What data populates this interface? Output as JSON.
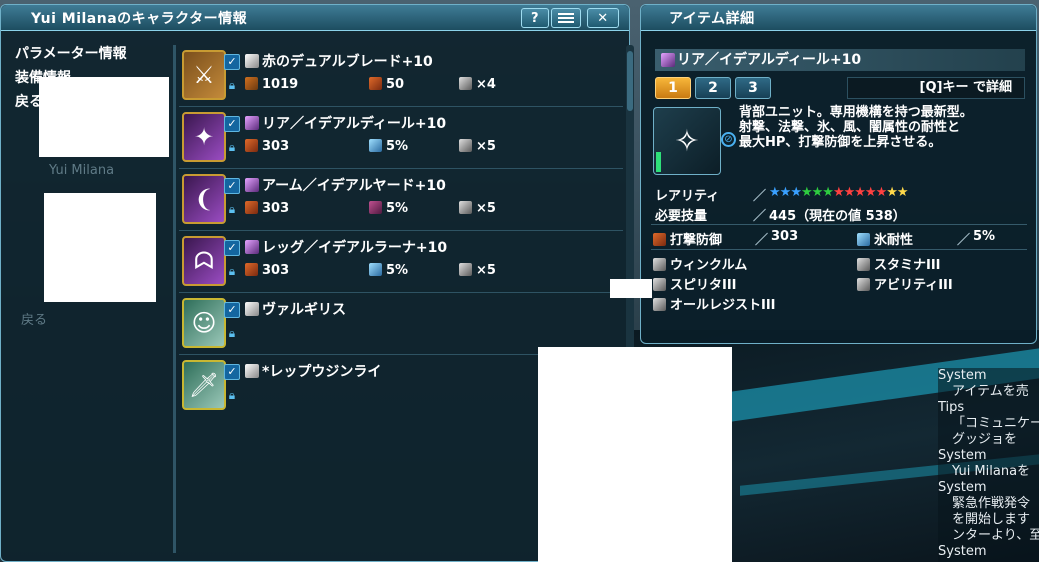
{
  "left_window": {
    "title": "Yui Milanaのキャラクター情報",
    "buttons": {
      "help": "?",
      "menu": "",
      "close": "✕"
    },
    "sidebar": {
      "items": [
        {
          "label": "パラメーター情報"
        },
        {
          "label": "装備情報"
        },
        {
          "label": "戻る"
        }
      ],
      "ghost_name": "Yui Milana",
      "ghost_back": "戻る"
    },
    "equipment": [
      {
        "name": "赤のデュアルブレード+10",
        "icon": "dual-blades-icon",
        "color": "orange",
        "stat1_value": "1019",
        "stat2_value": "50",
        "slots": "×4"
      },
      {
        "name": "リア／イデアルディール+10",
        "icon": "rear-unit-icon",
        "color": "purple",
        "stat1_value": "303",
        "stat2_value": "5%",
        "slots": "×5"
      },
      {
        "name": "アーム／イデアルヤード+10",
        "icon": "arm-unit-icon",
        "color": "purple",
        "stat1_value": "303",
        "stat2_value": "5%",
        "slots": "×5"
      },
      {
        "name": "レッグ／イデアルラーナ+10",
        "icon": "leg-unit-icon",
        "color": "purple",
        "stat1_value": "303",
        "stat2_value": "5%",
        "slots": "×5"
      },
      {
        "name": "ヴァルギリス",
        "icon": "costume-icon",
        "color": "green"
      },
      {
        "name": "*レップウジンライ",
        "icon": "weapon-camo-icon",
        "color": "green"
      }
    ]
  },
  "right_window": {
    "title": "アイテム詳細",
    "item_name": "リア／イデアルディール+10",
    "tabs": [
      "1",
      "2",
      "3"
    ],
    "active_tab": 0,
    "detail_hint": "[Q]キー で詳細",
    "description": "背部ユニット。専用機構を持つ最新型。\n射撃、法撃、氷、風、闇属性の耐性と\n最大HP、打撃防御を上昇させる。",
    "rarity_label": "レアリティ",
    "rarity_stars": 13,
    "requirement_label": "必要技量",
    "requirement_value": "445（現在の値 538）",
    "defense_label": "打撃防御",
    "defense_value": "303",
    "resist_label": "氷耐性",
    "resist_value": "5%",
    "abilities": [
      "ウィンクルム",
      "スタミナIII",
      "スピリタIII",
      "アビリティIII",
      "オールレジストIII"
    ]
  },
  "chat": [
    {
      "type": "System",
      "text": "アイテムを売"
    },
    {
      "type": "Tips",
      "text": "「コミュニケー"
    },
    {
      "type": "",
      "text": "グッジョを"
    },
    {
      "type": "System",
      "text": "Yui Milanaを"
    },
    {
      "type": "System",
      "text": "緊急作戦発令"
    },
    {
      "type": "",
      "text": "を開始します"
    },
    {
      "type": "",
      "text": "ンターより、至"
    },
    {
      "type": "System",
      "text": ""
    }
  ],
  "colors": {
    "accent": "#6fb0c8",
    "tab_active": "#f7b63a",
    "title_bar": "#3f7c96"
  }
}
